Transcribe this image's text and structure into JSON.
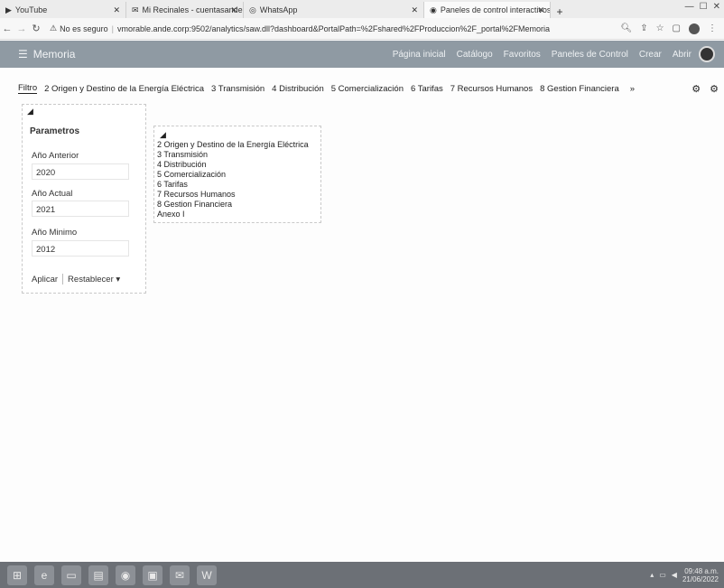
{
  "browser": {
    "tabs": [
      {
        "label": "YouTube",
        "active": false
      },
      {
        "label": "Mi Recinales - cuentasandeOnline",
        "active": false
      },
      {
        "label": "WhatsApp",
        "active": false
      },
      {
        "label": "Paneles de control interactivos",
        "active": true
      }
    ],
    "address": {
      "security": "No es seguro",
      "url": "vmorable.ande.corp:9502/analytics/saw.dll?dashboard&PortalPath=%2Fshared%2FProduccion%2F_portal%2FMemoria"
    }
  },
  "app": {
    "title": "Memoria",
    "menu": [
      "Página inicial",
      "Catálogo",
      "Favoritos",
      "Paneles de Control",
      "Crear",
      "Abrir"
    ]
  },
  "dashboard_tabs": [
    "Filtro",
    "2 Origen y Destino de la Energía Eléctrica",
    "3 Transmisión",
    "4 Distribución",
    "5 Comercialización",
    "6 Tarifas",
    "7 Recursos Humanos",
    "8 Gestion Financiera"
  ],
  "more_tabs": "»",
  "prompts": {
    "title": "Parametros",
    "fields": [
      {
        "label": "Año Anterior",
        "value": "2020"
      },
      {
        "label": "Año Actual",
        "value": "2021"
      },
      {
        "label": "Año Minimo",
        "value": "2012"
      }
    ],
    "apply": "Aplicar",
    "reset": "Restablecer ▾"
  },
  "link_list": [
    "2 Origen y Destino de la Energía Eléctrica",
    "3 Transmisión",
    "4 Distribución",
    "5 Comercialización",
    "6 Tarifas",
    "7 Recursos Humanos",
    "8 Gestion Financiera",
    "Anexo I"
  ],
  "taskbar": {
    "clock": "09:48 a.m.",
    "date": "21/06/2022"
  }
}
